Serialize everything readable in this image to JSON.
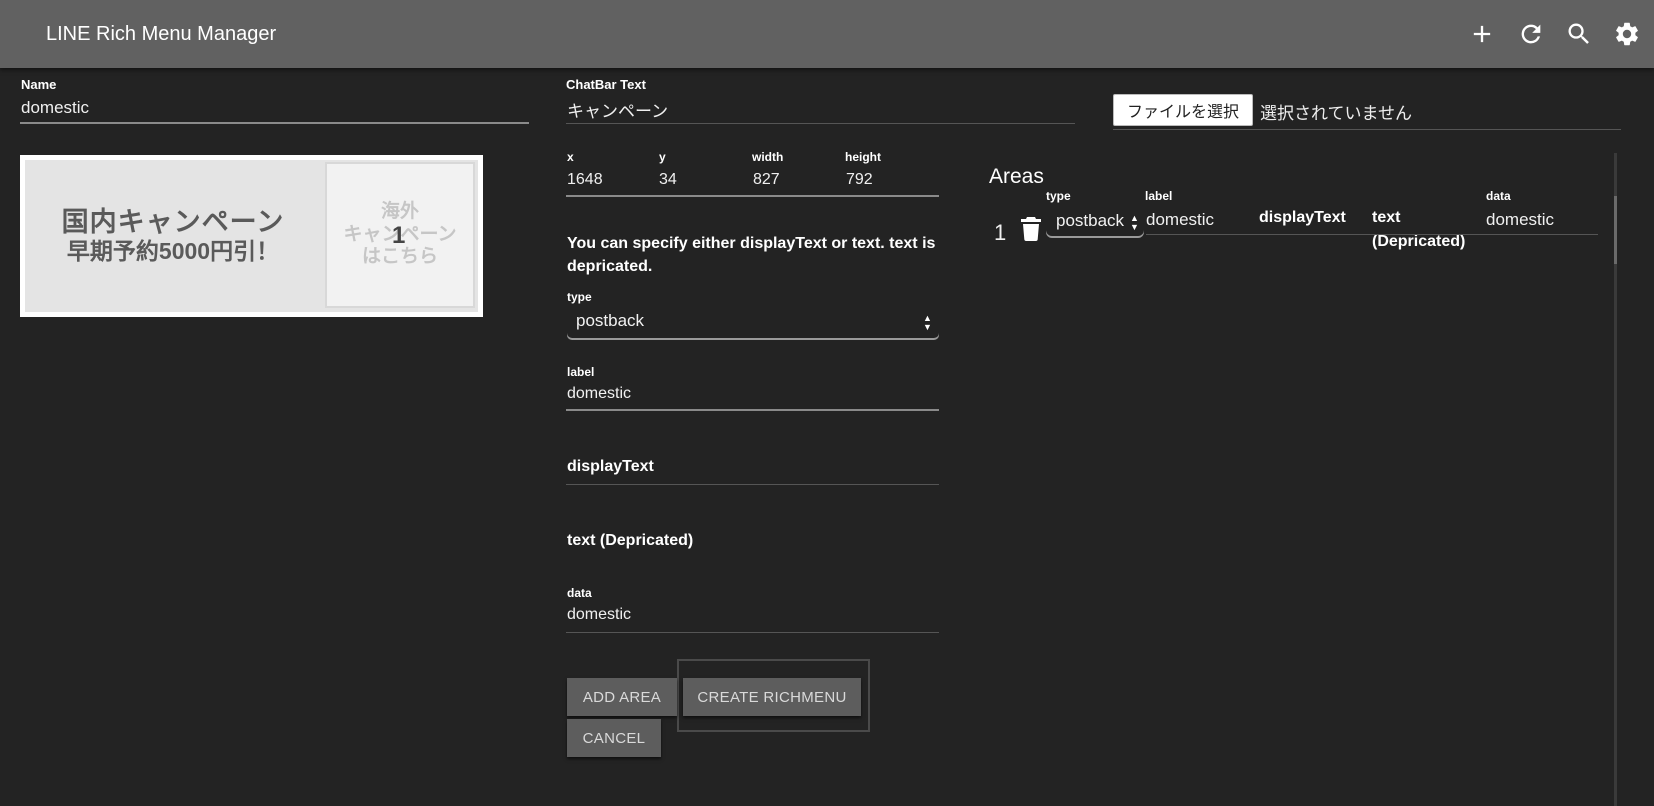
{
  "appbar": {
    "title": "LINE Rich Menu Manager",
    "icons": [
      "add-icon",
      "refresh-icon",
      "search-icon",
      "settings-icon"
    ]
  },
  "form": {
    "name_label": "Name",
    "name_value": "domestic",
    "chatbar_label": "ChatBar Text",
    "chatbar_value": "キャンペーン",
    "file_button": "ファイルを選択",
    "file_status": "選択されていません"
  },
  "preview": {
    "left_line1": "国内キャンペーン",
    "left_line2": "早期予約5000円引！",
    "right_line1": "海外",
    "right_line2": "キャンペーン",
    "right_line3": "はこちら",
    "area_number": "1"
  },
  "area_editor": {
    "x_label": "x",
    "x_value": "1648",
    "y_label": "y",
    "y_value": "34",
    "width_label": "width",
    "width_value": "827",
    "height_label": "height",
    "height_value": "792",
    "note": "You can specify either displayText or text. text is depricated.",
    "type_label": "type",
    "type_value": "postback",
    "label_label": "label",
    "label_value": "domestic",
    "display_text_heading": "displayText",
    "text_heading": "text (Depricated)",
    "data_label": "data",
    "data_value": "domestic"
  },
  "buttons": {
    "add_area": "ADD AREA",
    "create_richmenu": "CREATE RICHMENU",
    "cancel": "CANCEL"
  },
  "areas_table": {
    "title": "Areas",
    "columns": {
      "type": "type",
      "label": "label",
      "display_text": "displayText",
      "text_line1": "text",
      "text_line2": "(Depricated)",
      "data": "data"
    },
    "rows": [
      {
        "index": "1",
        "type": "postback",
        "label": "domestic",
        "data": "domestic"
      }
    ]
  }
}
